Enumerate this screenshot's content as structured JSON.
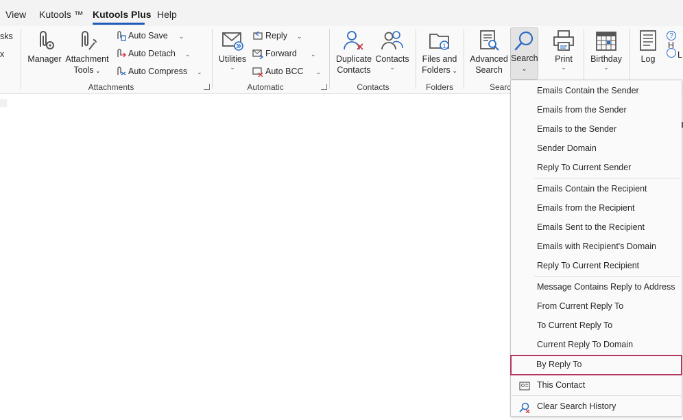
{
  "menu": {
    "tabs": [
      {
        "label": "View"
      },
      {
        "label": "Kutools ™"
      },
      {
        "label": "Kutools Plus",
        "active": true
      },
      {
        "label": "Help"
      }
    ]
  },
  "left_partial": [
    "sks",
    "x"
  ],
  "ribbon": {
    "attachments": {
      "label": "Attachments",
      "manager": "Manager",
      "attachment_tools": [
        "Attachment",
        "Tools"
      ],
      "auto_save": "Auto Save",
      "auto_detach": "Auto Detach",
      "auto_compress": "Auto Compress"
    },
    "automatic": {
      "label": "Automatic",
      "utilities": "Utilities",
      "reply": "Reply",
      "forward": "Forward",
      "auto_bcc": "Auto BCC"
    },
    "contacts": {
      "label": "Contacts",
      "duplicate_contacts": [
        "Duplicate",
        "Contacts"
      ],
      "contacts": "Contacts"
    },
    "folders": {
      "label": "Folders",
      "files_and_folders": [
        "Files and",
        "Folders"
      ]
    },
    "search": {
      "label": "Searc",
      "advanced_search": [
        "Advanced",
        "Search"
      ],
      "search": "Search"
    },
    "print": "Print",
    "birthday": "Birthday",
    "log": "Log",
    "right_partial": [
      "H",
      "L"
    ]
  },
  "search_menu": {
    "items": [
      "Emails Contain the Sender",
      "Emails from the Sender",
      "Emails to the Sender",
      "Sender Domain",
      "Reply To Current Sender",
      "Emails Contain the Recipient",
      "Emails from the Recipient",
      "Emails Sent to the Recipient",
      "Emails with Recipient's Domain",
      "Reply To Current Recipient",
      "Message Contains Reply to Address",
      "From Current Reply To",
      "To Current Reply To",
      "Current Reply To Domain",
      "By Reply To",
      "This Contact",
      "Clear Search History"
    ],
    "highlighted_item": "By Reply To",
    "highlight_color": "#b0395d"
  },
  "colors": {
    "accent": "#1e5bb5",
    "icon_blue": "#2b6cc4",
    "icon_red": "#d13438"
  }
}
